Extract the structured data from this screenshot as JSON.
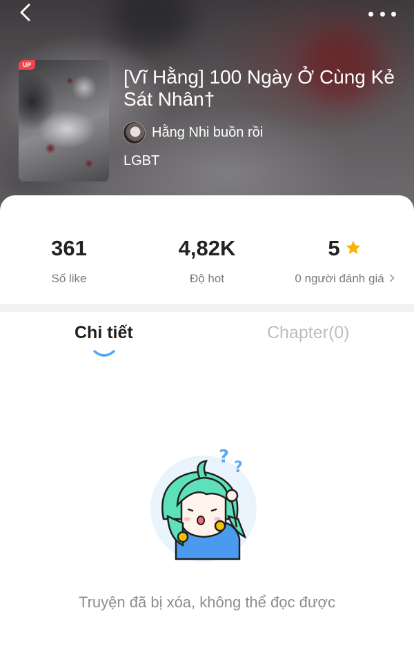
{
  "header": {
    "back_icon": "chevron-left-icon",
    "more_icon": "more-dots-icon"
  },
  "story": {
    "cover_badge": "UP",
    "title": "[Vĩ Hằng] 100 Ngày Ở Cùng Kẻ Sát Nhân†",
    "author": "Hằng Nhi buồn rồi",
    "genre": "LGBT"
  },
  "stats": {
    "likes": {
      "value": "361",
      "label": "Số like"
    },
    "hot": {
      "value": "4,82K",
      "label": "Độ hot"
    },
    "rating": {
      "value": "5",
      "label": "0 người đánh giá"
    }
  },
  "tabs": {
    "details": "Chi tiết",
    "chapters": "Chapter(0)",
    "active": "details"
  },
  "empty_state": {
    "message": "Truyện đã bị xóa, không thể đọc được"
  },
  "colors": {
    "accent_blue": "#4fa8f5",
    "star_yellow": "#f7b500",
    "badge_red": "#f0454d"
  }
}
